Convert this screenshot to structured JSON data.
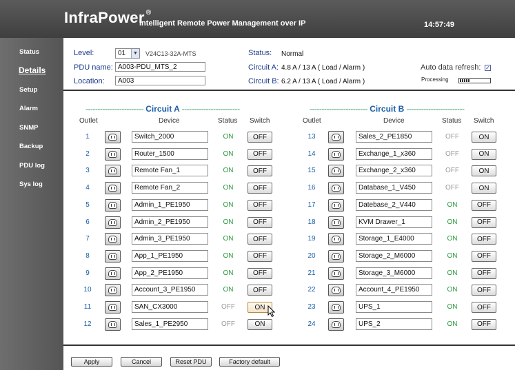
{
  "header": {
    "brand": "InfraPower",
    "reg_mark": "®",
    "tagline": "Intelligent Remote Power Management over IP",
    "clock": "14:57:49"
  },
  "sidebar": {
    "items": [
      {
        "label": "Status",
        "active": false
      },
      {
        "label": "Details",
        "active": true
      },
      {
        "label": "Setup",
        "active": false
      },
      {
        "label": "Alarm",
        "active": false
      },
      {
        "label": "SNMP",
        "active": false
      },
      {
        "label": "Backup",
        "active": false
      },
      {
        "label": "PDU log",
        "active": false
      },
      {
        "label": "Sys log",
        "active": false
      }
    ]
  },
  "info": {
    "level_label": "Level:",
    "level_value": "01",
    "model": "V24C13-32A-MTS",
    "pdu_name_label": "PDU name:",
    "pdu_name_value": "A003-PDU_MTS_2",
    "location_label": "Location:",
    "location_value": "A003",
    "status_label": "Status:",
    "status_value": "Normal",
    "circuit_a_label": "Circuit A:",
    "circuit_a_value": "4.8 A / 13 A ( Load / Alarm )",
    "circuit_b_label": "Circuit B:",
    "circuit_b_value": "6.2 A / 13 A ( Load / Alarm )",
    "auto_refresh_label": "Auto data refresh:",
    "auto_refresh_checked": true,
    "processing_label": "Processing",
    "processing_progress": 0.35
  },
  "circuit_a": {
    "title": "Circuit  A",
    "columns": {
      "outlet": "Outlet",
      "device": "Device",
      "status": "Status",
      "switch": "Switch"
    },
    "rows": [
      {
        "outlet": "1",
        "device": "Switch_2000",
        "status": "ON",
        "switch": "OFF"
      },
      {
        "outlet": "2",
        "device": "Router_1500",
        "status": "ON",
        "switch": "OFF"
      },
      {
        "outlet": "3",
        "device": "Remote Fan_1",
        "status": "ON",
        "switch": "OFF"
      },
      {
        "outlet": "4",
        "device": "Remote Fan_2",
        "status": "ON",
        "switch": "OFF"
      },
      {
        "outlet": "5",
        "device": "Admin_1_PE1950",
        "status": "ON",
        "switch": "OFF"
      },
      {
        "outlet": "6",
        "device": "Admin_2_PE1950",
        "status": "ON",
        "switch": "OFF"
      },
      {
        "outlet": "7",
        "device": "Admin_3_PE1950",
        "status": "ON",
        "switch": "OFF"
      },
      {
        "outlet": "8",
        "device": "App_1_PE1950",
        "status": "ON",
        "switch": "OFF"
      },
      {
        "outlet": "9",
        "device": "App_2_PE1950",
        "status": "ON",
        "switch": "OFF"
      },
      {
        "outlet": "10",
        "device": "Account_3_PE1950",
        "status": "ON",
        "switch": "OFF"
      },
      {
        "outlet": "11",
        "device": "SAN_CX3000",
        "status": "OFF",
        "switch": "ON"
      },
      {
        "outlet": "12",
        "device": "Sales_1_PE2950",
        "status": "OFF",
        "switch": "ON"
      }
    ]
  },
  "circuit_b": {
    "title": "Circuit  B",
    "columns": {
      "outlet": "Outlet",
      "device": "Device",
      "status": "Status",
      "switch": "Switch"
    },
    "rows": [
      {
        "outlet": "13",
        "device": "Sales_2_PE1850",
        "status": "OFF",
        "switch": "ON"
      },
      {
        "outlet": "14",
        "device": "Exchange_1_x360",
        "status": "OFF",
        "switch": "ON"
      },
      {
        "outlet": "15",
        "device": "Exchange_2_x360",
        "status": "OFF",
        "switch": "ON"
      },
      {
        "outlet": "16",
        "device": "Database_1_V450",
        "status": "OFF",
        "switch": "ON"
      },
      {
        "outlet": "17",
        "device": "Datebase_2_V440",
        "status": "ON",
        "switch": "OFF"
      },
      {
        "outlet": "18",
        "device": "KVM Drawer_1",
        "status": "ON",
        "switch": "OFF"
      },
      {
        "outlet": "19",
        "device": "Storage_1_E4000",
        "status": "ON",
        "switch": "OFF"
      },
      {
        "outlet": "20",
        "device": "Storage_2_M6000",
        "status": "ON",
        "switch": "OFF"
      },
      {
        "outlet": "21",
        "device": "Storage_3_M6000",
        "status": "ON",
        "switch": "OFF"
      },
      {
        "outlet": "22",
        "device": "Account_4_PE1950",
        "status": "ON",
        "switch": "OFF"
      },
      {
        "outlet": "23",
        "device": "UPS_1",
        "status": "ON",
        "switch": "OFF"
      },
      {
        "outlet": "24",
        "device": "UPS_2",
        "status": "ON",
        "switch": "OFF"
      }
    ]
  },
  "footer": {
    "apply": "Apply",
    "cancel": "Cancel",
    "reset": "Reset PDU",
    "factory": "Factory default"
  },
  "colors": {
    "header_bg": "#4a4a4a",
    "sidebar_bg": "#606060",
    "accent_blue": "#1a5fa8",
    "status_on": "#2a9a3a",
    "status_off": "#9a9a9a",
    "dash_green": "#2aa060"
  }
}
